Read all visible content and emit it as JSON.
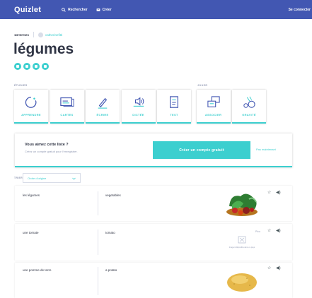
{
  "nav": {
    "logo": "Quizlet",
    "search_label": "Rechercher",
    "create_label": "Créer",
    "signin_label": "Se connecter"
  },
  "set": {
    "term_count": "14 termes",
    "author": "catherinefitti",
    "title": "légumes"
  },
  "sections": {
    "study_label": "ÉTUDIER",
    "play_label": "JOUER"
  },
  "modes": [
    {
      "label": "APPRENDRE",
      "icon": "learn-icon"
    },
    {
      "label": "CARTES",
      "icon": "flashcards-icon"
    },
    {
      "label": "ÉCRIRE",
      "icon": "write-icon"
    },
    {
      "label": "DICTÉE",
      "icon": "spell-icon"
    },
    {
      "label": "TEST",
      "icon": "test-icon"
    },
    {
      "label": "ASSOCIER",
      "icon": "match-icon"
    },
    {
      "label": "GRAVITÉ",
      "icon": "gravity-icon"
    }
  ],
  "promo": {
    "title": "Vous aimez cette liste ?",
    "subtitle": "Créez un compte gratuit pour l'enregistrer.",
    "cta": "Créer un compte gratuit",
    "later": "Pas maintenant"
  },
  "sort": {
    "label": "TRIER",
    "selected": "Ordre d'origine"
  },
  "terms": [
    {
      "term": "les légumes",
      "definition": "vegetables",
      "image": "vegetables-photo"
    },
    {
      "term": "une tomate",
      "definition": "tomato",
      "image": "no-image",
      "tag": "Pico",
      "image_caption": "Image indisponible dans ce pays"
    },
    {
      "term": "une pomme de terre",
      "definition": "a potato",
      "image": "potato-photo"
    }
  ],
  "colors": {
    "nav_bg": "#4257b2",
    "accent": "#3ccfcf",
    "text_dark": "#303545",
    "text_muted": "#939bb4",
    "list_bg": "#f0f0f2"
  }
}
